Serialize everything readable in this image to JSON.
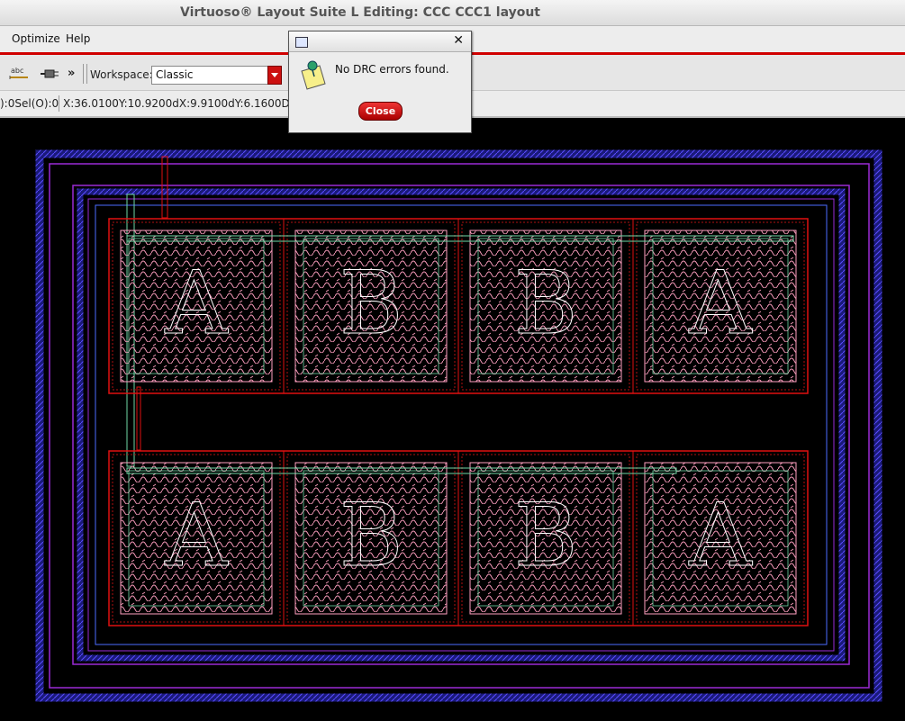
{
  "window": {
    "title": "Virtuoso® Layout Suite L Editing: CCC CCC1 layout"
  },
  "menubar": {
    "items": [
      {
        "label": "Optimize"
      },
      {
        "label": "Help"
      }
    ]
  },
  "toolbar": {
    "overflow_label": "»",
    "workspace_label": "Workspace:",
    "workspace_value": "Classic",
    "icons": [
      "text-label-icon",
      "plug-icon"
    ]
  },
  "statusbar": {
    "select_counts": "):0Sel(O):0",
    "coords": "X:36.0100Y:10.9200dX:9.9100dY:6.1600Dis"
  },
  "dialog": {
    "message": "No DRC errors found.",
    "close_label": "Close"
  },
  "layout": {
    "cell_labels_row1": [
      "A",
      "B",
      "B",
      "A"
    ],
    "cell_labels_row2": [
      "A",
      "B",
      "B",
      "A"
    ],
    "colors": {
      "outer_ring": "#3b2bd6",
      "guard_ring": "#9a2bd6",
      "cell_boundary": "#e01010",
      "metal_fill": "#ff9fc0",
      "route": "#6fd8a6"
    }
  }
}
